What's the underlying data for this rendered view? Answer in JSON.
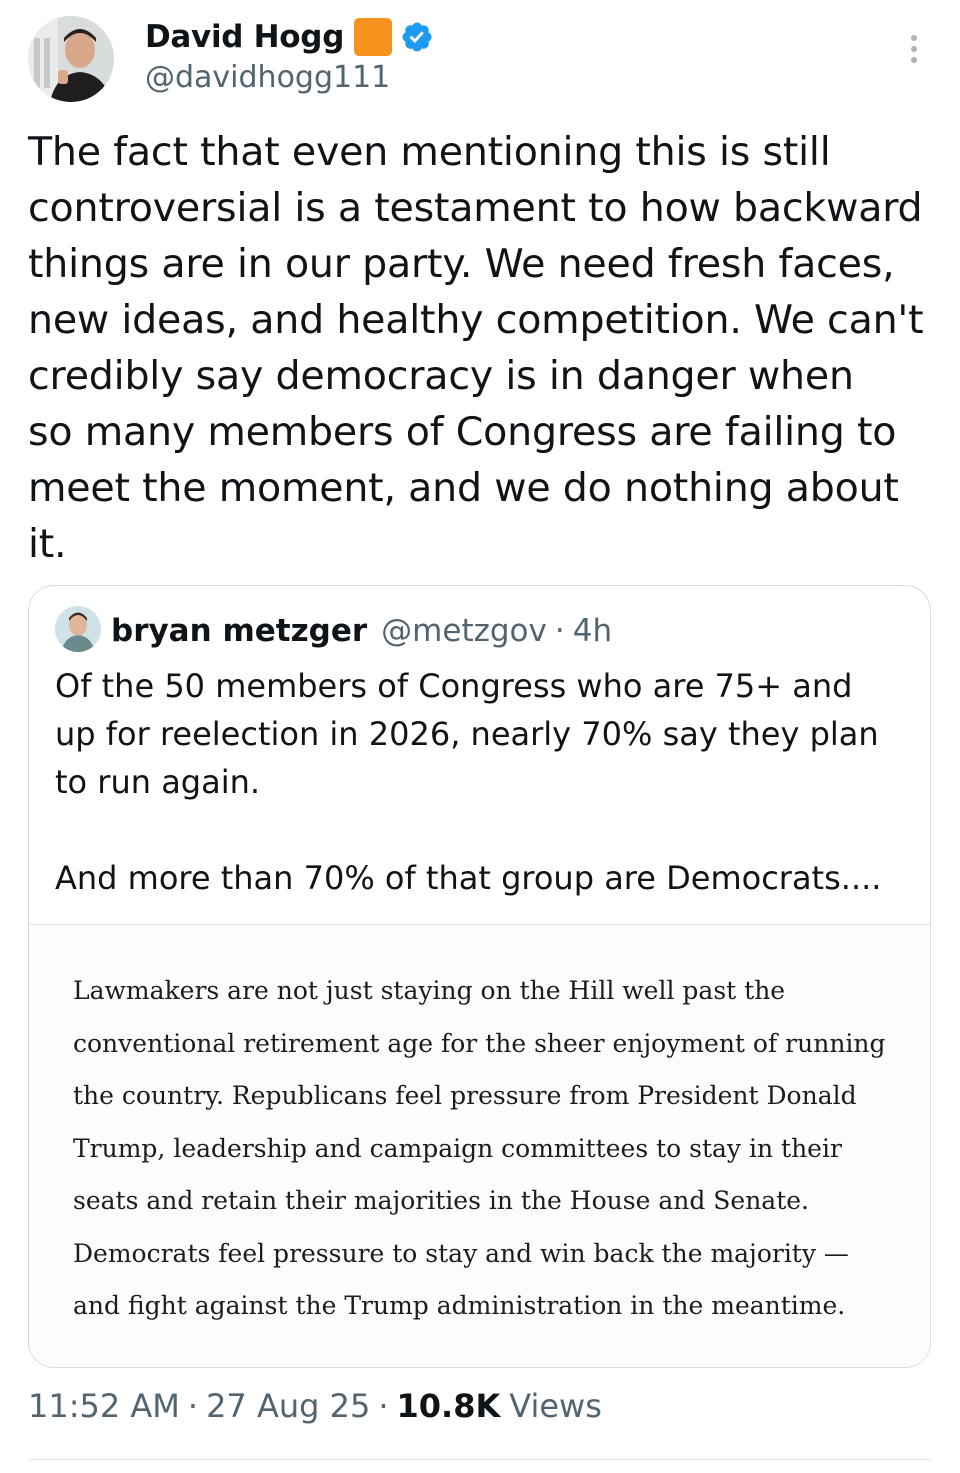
{
  "author": {
    "display_name": "David Hogg",
    "handle": "@davidhogg111",
    "badge_color": "#f7931e",
    "verified_icon": "verified-badge-icon",
    "verified_color": "#1d9bf0"
  },
  "tweet": {
    "lines": [
      "The fact that even mentioning this is still",
      "controversial is a testament to how backward",
      "things are in our party. We need fresh faces,",
      "new ideas, and healthy competition. We can't",
      "credibly say democracy is in danger when",
      "so many members of Congress are failing to",
      "meet the moment, and we do nothing about",
      "it."
    ]
  },
  "quote": {
    "display_name": "bryan metzger",
    "handle": "@metzgov",
    "separator": "·",
    "time": "4h",
    "lines": [
      "Of the 50 members of Congress who are 75+ and",
      "up for reelection in 2026, nearly 70% say they plan",
      "to run again.",
      "And more than 70% of that group are Democrats...."
    ],
    "image_lines": [
      "Lawmakers are not just staying on the Hill well past the",
      "conventional retirement age for the sheer enjoyment of running",
      "the country. Republicans feel pressure from President Donald",
      "Trump, leadership and campaign committees to stay in their",
      "seats and retain their majorities in the House and Senate.",
      "Democrats feel pressure to stay and win back the majority —",
      "and fight against the Trump administration in the meantime."
    ]
  },
  "meta": {
    "time": "11:52 AM",
    "date": "27 Aug 25",
    "views_count": "10.8K",
    "views_label": "Views",
    "separator": "·"
  },
  "icons": {
    "more": "more-vertical-icon"
  }
}
